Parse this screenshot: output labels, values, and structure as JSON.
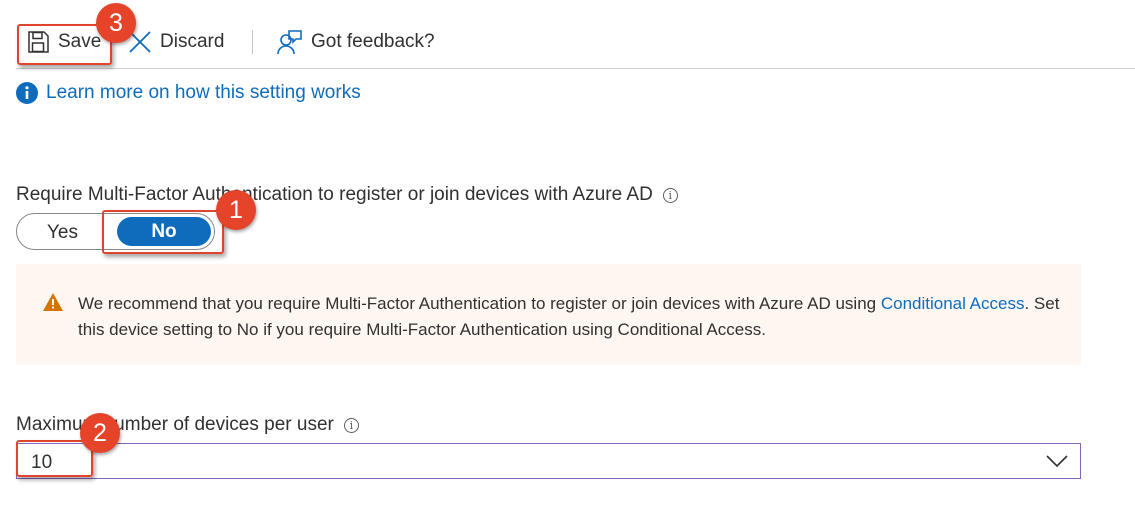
{
  "toolbar": {
    "save_label": "Save",
    "discard_label": "Discard",
    "feedback_label": "Got feedback?"
  },
  "learn_more": {
    "link_text": "Learn more on how this setting works"
  },
  "mfa_setting": {
    "label": "Require Multi-Factor Authentication to register or join devices with Azure AD",
    "option_yes": "Yes",
    "option_no": "No",
    "selected": "No"
  },
  "warning": {
    "text": "We recommend that you require Multi-Factor Authentication to register or join devices with Azure AD using ",
    "link_text": "Conditional Access",
    "text_after": ". Set this device setting to No if you require Multi-Factor Authentication using Conditional Access."
  },
  "max_devices": {
    "label": "Maximum number of devices per user",
    "value": "10"
  },
  "callouts": {
    "one": "1",
    "two": "2",
    "three": "3"
  },
  "colors": {
    "accent": "#0f6cbd",
    "callout": "#e5442a",
    "warning_bg": "#fdf6f1",
    "warning_icon": "#d47500",
    "dropdown_border": "#8764b8"
  }
}
